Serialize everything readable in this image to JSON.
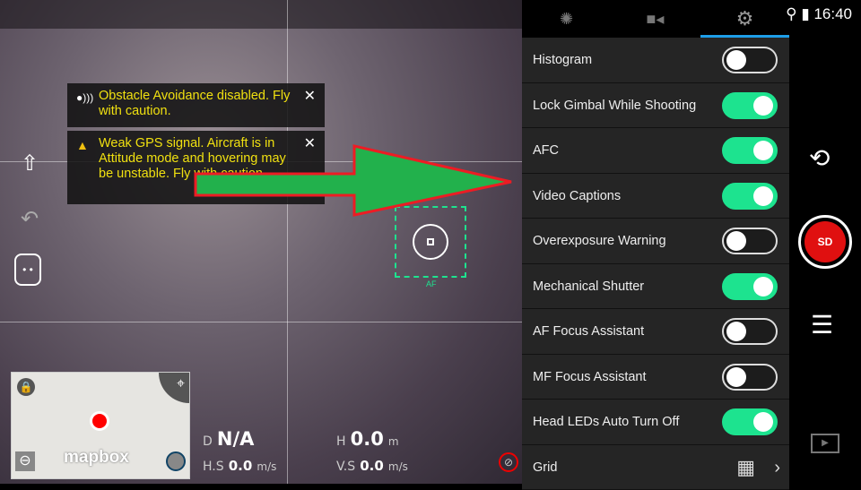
{
  "status_bar": {
    "time": "16:40",
    "icons": [
      "location-pin-icon",
      "battery-charging-icon"
    ]
  },
  "camera_tabs": [
    {
      "name": "photo-settings",
      "icon": "aperture-icon"
    },
    {
      "name": "video-settings",
      "icon": "video-camera-icon"
    },
    {
      "name": "general-settings",
      "icon": "gear-icon",
      "active": true
    }
  ],
  "notifications": [
    {
      "icon": "obstacle-sensor-icon",
      "text": "Obstacle Avoidance disabled. Fly with caution."
    },
    {
      "icon": "warning-icon",
      "text": "Weak GPS signal. Aircraft is in Attitude mode and hovering may be unstable. Fly with caution."
    }
  ],
  "focus": {
    "label": "AF"
  },
  "map": {
    "brand": "mapbox"
  },
  "telemetry": {
    "d_label": "D",
    "d_value": "N/A",
    "h_label": "H",
    "h_value": "0.0",
    "h_unit": "m",
    "hs_label": "H.S",
    "hs_value": "0.0",
    "hs_unit": "m/s",
    "vs_label": "V.S",
    "vs_value": "0.0",
    "vs_unit": "m/s"
  },
  "settings": [
    {
      "label": "Histogram",
      "on": false
    },
    {
      "label": "Lock Gimbal While Shooting",
      "on": true
    },
    {
      "label": "AFC",
      "on": true
    },
    {
      "label": "Video Captions",
      "on": true
    },
    {
      "label": "Overexposure Warning",
      "on": false
    },
    {
      "label": "Mechanical Shutter",
      "on": true
    },
    {
      "label": "AF Focus Assistant",
      "on": false
    },
    {
      "label": "MF Focus Assistant",
      "on": false
    },
    {
      "label": "Head LEDs Auto Turn Off",
      "on": true
    }
  ],
  "grid_row": {
    "label": "Grid"
  },
  "record_button": {
    "label": "SD"
  },
  "colors": {
    "accent": "#1de38f",
    "tab_underline": "#1e9ee8",
    "warning": "#f0e010",
    "record": "#e01010",
    "arrow": "#22b14c",
    "arrow_outline": "#ed1c24"
  }
}
